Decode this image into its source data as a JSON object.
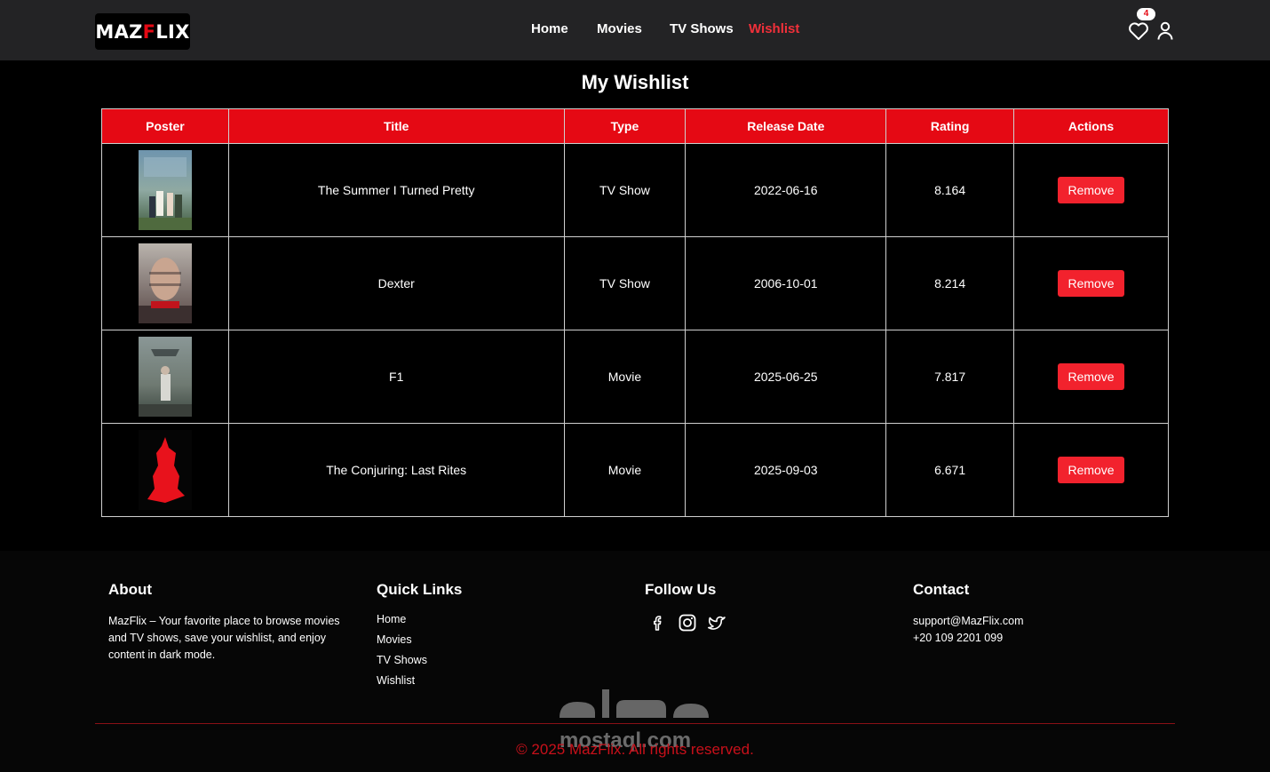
{
  "brand": {
    "logo_part1": "MAZ",
    "logo_part2": "F",
    "logo_part3": "LIX"
  },
  "nav": {
    "home": "Home",
    "movies": "Movies",
    "tv_shows": "TV Shows",
    "wishlist": "Wishlist",
    "wishlist_count": "4",
    "active": "Wishlist"
  },
  "page": {
    "title": "My Wishlist"
  },
  "table": {
    "headers": [
      "Poster",
      "Title",
      "Type",
      "Release Date",
      "Rating",
      "Actions"
    ],
    "rows": [
      {
        "title": "The Summer I Turned Pretty",
        "type": "TV Show",
        "release_date": "2022-06-16",
        "rating": "8.164",
        "action": "Remove"
      },
      {
        "title": "Dexter",
        "type": "TV Show",
        "release_date": "2006-10-01",
        "rating": "8.214",
        "action": "Remove"
      },
      {
        "title": "F1",
        "type": "Movie",
        "release_date": "2025-06-25",
        "rating": "7.817",
        "action": "Remove"
      },
      {
        "title": "The Conjuring: Last Rites",
        "type": "Movie",
        "release_date": "2025-09-03",
        "rating": "6.671",
        "action": "Remove"
      }
    ]
  },
  "footer": {
    "about": {
      "heading": "About",
      "text": "MazFlix – Your favorite place to browse movies and TV shows, save your wishlist, and enjoy content in dark mode."
    },
    "quick_links": {
      "heading": "Quick Links",
      "items": [
        "Home",
        "Movies",
        "TV Shows",
        "Wishlist"
      ]
    },
    "follow": {
      "heading": "Follow Us",
      "icons": [
        "facebook-icon",
        "instagram-icon",
        "twitter-icon"
      ]
    },
    "contact": {
      "heading": "Contact",
      "email": "support@MazFlix.com",
      "phone": "+20 109 2201 099"
    },
    "copyright": "© 2025 MazFlix. All rights reserved.",
    "watermark": "mostaql.com"
  },
  "colors": {
    "accent": "#e50914",
    "nav_bg": "#232325",
    "footer_bg": "#060606"
  }
}
